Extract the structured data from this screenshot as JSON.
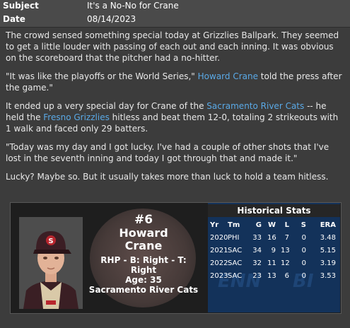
{
  "header": {
    "subject_label": "Subject",
    "subject_value": "It's a No-No for Crane",
    "date_label": "Date",
    "date_value": "08/14/2023"
  },
  "article": {
    "p1": "The crowd sensed something special today at Grizzlies Ballpark. They seemed to get a little louder with passing of each out and each inning. It was obvious on the scoreboard that the pitcher had a no-hitter.",
    "p2_a": "\"It was like the playoffs or the World Series,\" ",
    "p2_link": "Howard Crane",
    "p2_b": " told the press after the game.\"",
    "p3_a": "It ended up a very special day for Crane of the ",
    "p3_link1": "Sacramento River Cats",
    "p3_b": " -- he held the ",
    "p3_link2": "Fresno Grizzlies",
    "p3_c": " hitless and beat them 12-0, totaling 2 strikeouts with 1 walk and faced only 29 batters.",
    "p4": "\"Today was my day and I got lucky. I've had a couple of other shots that I've lost in the seventh inning and today I got through that and made it.\"",
    "p5": "Lucky? Maybe so. But it usually takes more than luck to hold a team hitless."
  },
  "player": {
    "number": "#6",
    "first_name": "Howard",
    "last_name": "Crane",
    "line1": "RHP - B: Right - T: Right",
    "line2": "Age: 35",
    "team": "Sacramento River Cats"
  },
  "stats": {
    "title": "Historical Stats",
    "columns": [
      "Yr",
      "Tm",
      "G",
      "W",
      "L",
      "S",
      "ERA"
    ],
    "rows": [
      [
        "2020",
        "PHI",
        "33",
        "16",
        "7",
        "0",
        "3.48"
      ],
      [
        "2021",
        "SAC",
        "34",
        "9",
        "13",
        "0",
        "5.15"
      ],
      [
        "2022",
        "SAC",
        "32",
        "11",
        "12",
        "0",
        "3.19"
      ],
      [
        "2023",
        "SAC",
        "23",
        "13",
        "6",
        "0",
        "3.53"
      ]
    ]
  },
  "colors": {
    "background": "#3c3c3c",
    "header_bar": "#4a4a4a",
    "link": "#5aa9e6",
    "stats_bg": "#13325a",
    "card_bg": "#1e1e1e"
  }
}
